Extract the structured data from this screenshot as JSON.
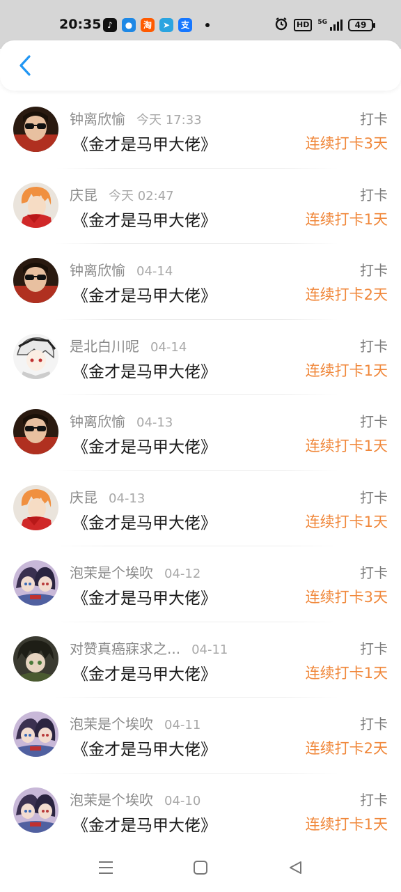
{
  "status_bar": {
    "time": "20:35",
    "hd": "HD",
    "network": "5G",
    "battery": "49",
    "apps": [
      {
        "name": "douyin-icon",
        "glyph": "♪",
        "bg": "#111111"
      },
      {
        "name": "browser-icon",
        "glyph": "●",
        "bg": "#1e88e5"
      },
      {
        "name": "taobao-icon",
        "glyph": "淘",
        "bg": "#ff5a00"
      },
      {
        "name": "telegram-icon",
        "glyph": "➤",
        "bg": "#2aa4e0"
      },
      {
        "name": "alipay-icon",
        "glyph": "支",
        "bg": "#1677ff"
      }
    ]
  },
  "colors": {
    "accent_back": "#2196f3",
    "streak": "#f0873a"
  },
  "items": [
    {
      "name": "钟离欣愉",
      "date": "今天 17:33",
      "book": "《金才是马甲大佬》",
      "action": "打卡",
      "streak": "连续打卡3天",
      "avatar": "sunglasses"
    },
    {
      "name": "庆昆",
      "date": "今天 02:47",
      "book": "《金才是马甲大佬》",
      "action": "打卡",
      "streak": "连续打卡1天",
      "avatar": "orange-hair"
    },
    {
      "name": "钟离欣愉",
      "date": "04-14",
      "book": "《金才是马甲大佬》",
      "action": "打卡",
      "streak": "连续打卡2天",
      "avatar": "sunglasses"
    },
    {
      "name": "是北白川呢",
      "date": "04-14",
      "book": "《金才是马甲大佬》",
      "action": "打卡",
      "streak": "连续打卡1天",
      "avatar": "white-hair"
    },
    {
      "name": "钟离欣愉",
      "date": "04-13",
      "book": "《金才是马甲大佬》",
      "action": "打卡",
      "streak": "连续打卡1天",
      "avatar": "sunglasses"
    },
    {
      "name": "庆昆",
      "date": "04-13",
      "book": "《金才是马甲大佬》",
      "action": "打卡",
      "streak": "连续打卡1天",
      "avatar": "orange-hair"
    },
    {
      "name": "泡茉是个埃吹",
      "date": "04-12",
      "book": "《金才是马甲大佬》",
      "action": "打卡",
      "streak": "连续打卡3天",
      "avatar": "anime-duo"
    },
    {
      "name": "对赞真癌寐求之...",
      "date": "04-11",
      "book": "《金才是马甲大佬》",
      "action": "打卡",
      "streak": "连续打卡1天",
      "avatar": "green-dark"
    },
    {
      "name": "泡茉是个埃吹",
      "date": "04-11",
      "book": "《金才是马甲大佬》",
      "action": "打卡",
      "streak": "连续打卡2天",
      "avatar": "anime-duo"
    },
    {
      "name": "泡茉是个埃吹",
      "date": "04-10",
      "book": "《金才是马甲大佬》",
      "action": "打卡",
      "streak": "连续打卡1天",
      "avatar": "anime-duo"
    }
  ]
}
